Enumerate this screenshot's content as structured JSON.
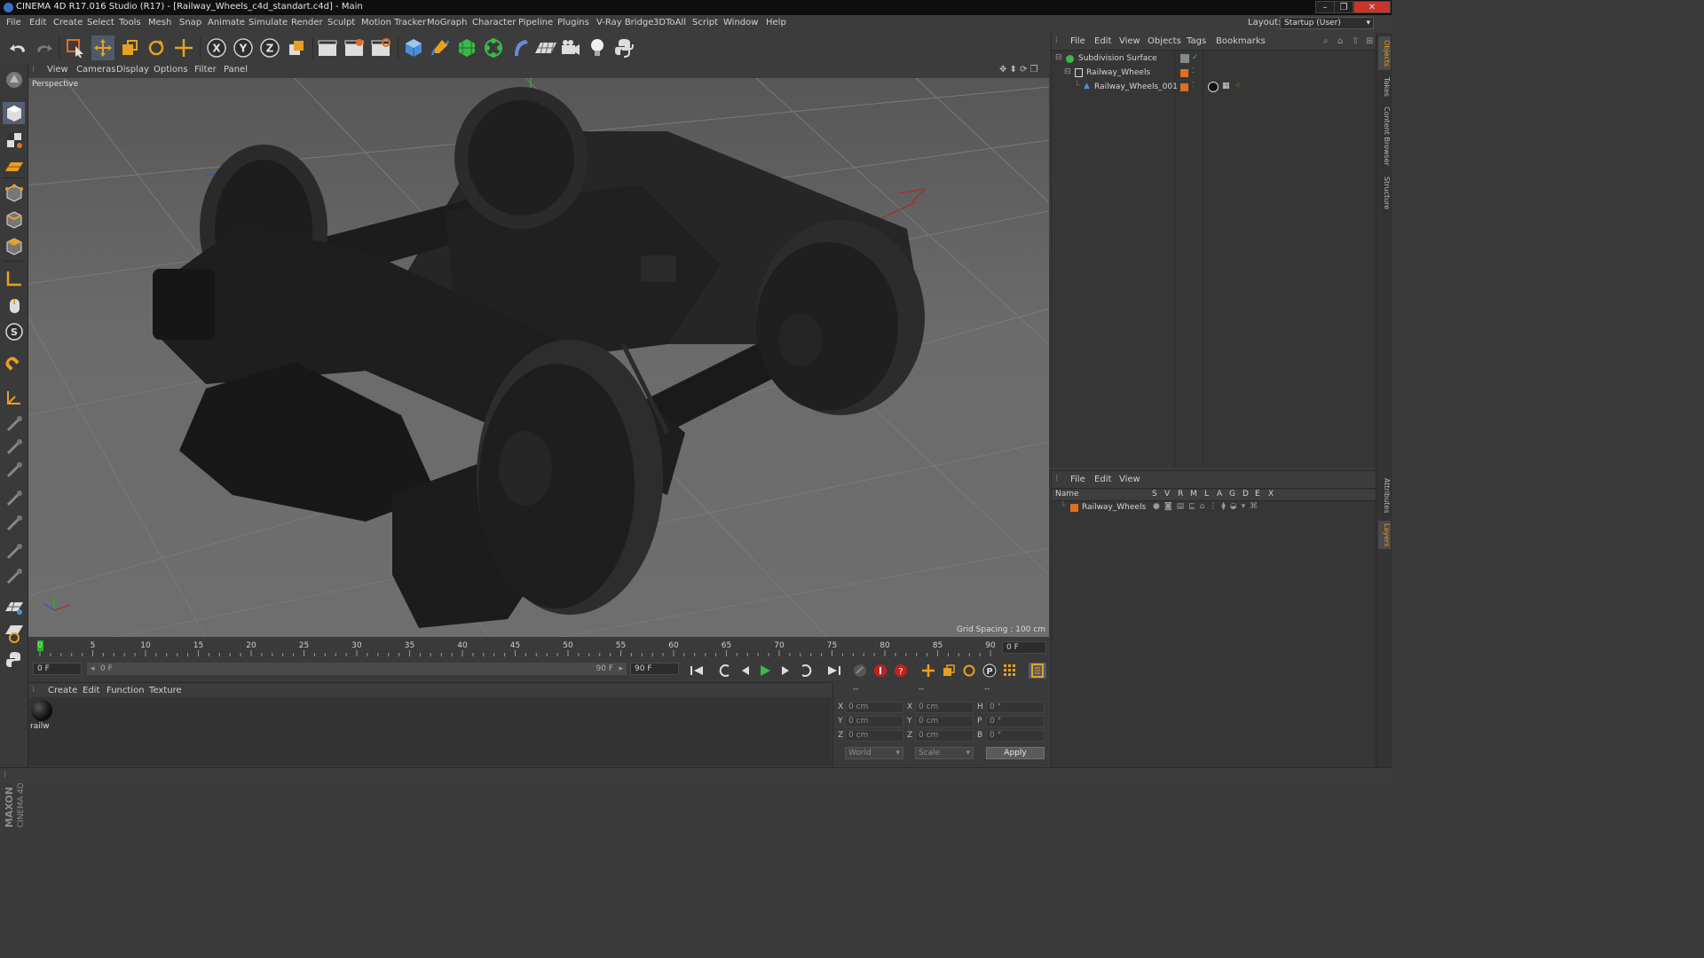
{
  "window": {
    "title": "CINEMA 4D R17.016 Studio (R17) - [Railway_Wheels_c4d_standart.c4d] - Main",
    "controls": [
      "–",
      "❐",
      "✕"
    ]
  },
  "menubar": {
    "items": [
      "File",
      "Edit",
      "Create",
      "Select",
      "Tools",
      "Mesh",
      "Snap",
      "Animate",
      "Simulate",
      "Render",
      "Sculpt",
      "Motion Tracker",
      "MoGraph",
      "Character",
      "Pipeline",
      "Plugins",
      "V-Ray Bridge",
      "3DToAll",
      "Script",
      "Window",
      "Help"
    ],
    "layout_label": "Layout:",
    "layout_value": "Startup (User)"
  },
  "toolbar": {
    "axis_x": "X",
    "axis_y": "Y",
    "axis_z": "Z"
  },
  "viewport": {
    "menu": [
      "View",
      "Cameras",
      "Display",
      "Options",
      "Filter",
      "Panel"
    ],
    "label": "Perspective",
    "grid_spacing": "Grid Spacing : 100 cm"
  },
  "timeline": {
    "ticks": [
      "0",
      "5",
      "10",
      "15",
      "20",
      "25",
      "30",
      "35",
      "40",
      "45",
      "50",
      "55",
      "60",
      "65",
      "70",
      "75",
      "80",
      "85",
      "90"
    ],
    "current_frame": "0 F",
    "start_field": "0 F",
    "range_start": "0 F",
    "range_end": "90 F",
    "end_field": "90 F"
  },
  "material_manager": {
    "menu": [
      "Create",
      "Edit",
      "Function",
      "Texture"
    ],
    "material_name": "railw"
  },
  "coordinates": {
    "headers": [
      "--",
      "--",
      "--"
    ],
    "rows": [
      {
        "a": "X",
        "av": "0 cm",
        "b": "X",
        "bv": "0 cm",
        "c": "H",
        "cv": "0 °"
      },
      {
        "a": "Y",
        "av": "0 cm",
        "b": "Y",
        "bv": "0 cm",
        "c": "P",
        "cv": "0 °"
      },
      {
        "a": "Z",
        "av": "0 cm",
        "b": "Z",
        "bv": "0 cm",
        "c": "B",
        "cv": "0 °"
      }
    ],
    "mode_world": "World",
    "mode_scale": "Scale",
    "apply": "Apply"
  },
  "object_manager": {
    "menu": [
      "File",
      "Edit",
      "View",
      "Objects",
      "Tags",
      "Bookmarks"
    ],
    "objects": [
      "Subdivision Surface",
      "Railway_Wheels",
      "Railway_Wheels_001"
    ]
  },
  "layer_manager": {
    "menu": [
      "File",
      "Edit",
      "View"
    ],
    "columns": [
      "Name",
      "S",
      "V",
      "R",
      "M",
      "L",
      "A",
      "G",
      "D",
      "E",
      "X"
    ],
    "layers": [
      "Railway_Wheels"
    ]
  },
  "side_tabs": [
    "Objects",
    "Takes",
    "Content Browser",
    "Structure",
    "Attributes",
    "Layers"
  ],
  "brand": {
    "maxon": "MAXON",
    "product": "CINEMA 4D"
  },
  "colors": {
    "accent_orange": "#e69a1e",
    "axis_y_green": "#19c019",
    "axis_x_red": "#d02020",
    "axis_z_blue": "#3050d0"
  }
}
